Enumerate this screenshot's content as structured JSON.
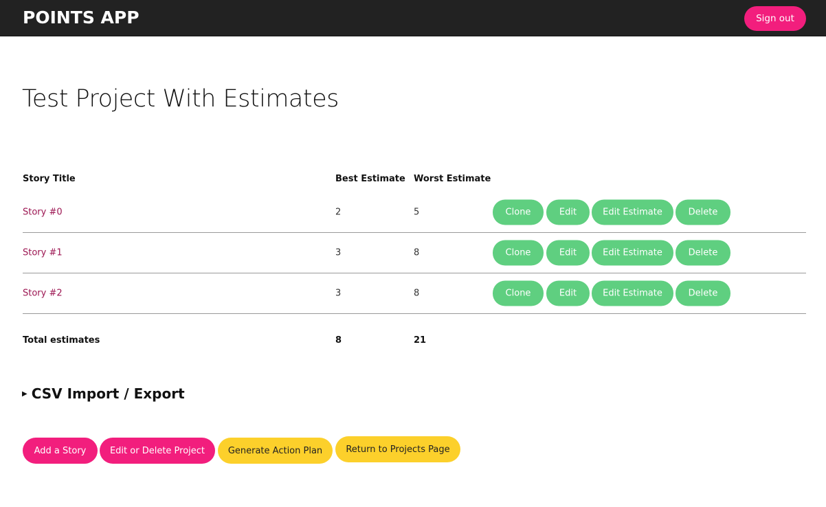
{
  "navbar": {
    "brand": "POINTS APP",
    "sign_out_label": "Sign out"
  },
  "page": {
    "title": "Test Project With Estimates"
  },
  "table": {
    "headers": {
      "story_title": "Story Title",
      "best_estimate": "Best Estimate",
      "worst_estimate": "Worst Estimate"
    },
    "rows": [
      {
        "title": "Story #0",
        "best": "2",
        "worst": "5"
      },
      {
        "title": "Story #1",
        "best": "3",
        "worst": "8"
      },
      {
        "title": "Story #2",
        "best": "3",
        "worst": "8"
      }
    ],
    "row_actions": {
      "clone": "Clone",
      "edit": "Edit",
      "edit_estimate": "Edit Estimate",
      "delete": "Delete"
    },
    "totals": {
      "label": "Total estimates",
      "best": "8",
      "worst": "21"
    }
  },
  "csv": {
    "summary": "CSV Import / Export",
    "expanded": false
  },
  "actions": {
    "add_story": "Add a Story",
    "edit_delete_project": "Edit or Delete Project",
    "generate_action_plan": "Generate Action Plan",
    "return_projects": "Return to Projects Page"
  },
  "colors": {
    "navbar_bg": "#222222",
    "primary_pink": "#f21e7d",
    "action_green": "#5fcf80",
    "accent_yellow": "#fcd02b",
    "link_color": "#9c1652"
  }
}
